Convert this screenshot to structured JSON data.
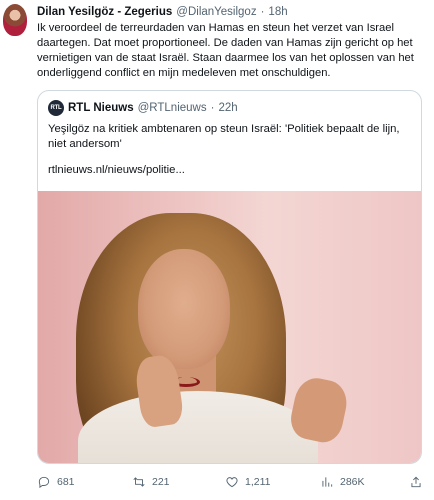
{
  "tweet": {
    "author_name": "Dilan Yesilgöz - Zegerius",
    "author_handle": "@DilanYesilgoz",
    "separator": "·",
    "time": "18h",
    "text": "Ik veroordeel de terreurdaden van Hamas en steun het verzet van Israel daartegen. Dat moet proportioneel. De daden van Hamas zijn gericht op het vernietigen van de staat Israël. Staan daarmee los van het oplossen van het onderliggend conflict en mijn medeleven met onschuldigen."
  },
  "quote": {
    "logo_text": "RTL",
    "name": "RTL Nieuws",
    "handle": "@RTLnieuws",
    "separator": "·",
    "time": "22h",
    "text": "Yeşilgöz na kritiek ambtenaren op steun Israël: 'Politiek bepaalt de lijn, niet andersom'",
    "link": "rtlnieuws.nl/nieuws/politie..."
  },
  "actions": {
    "replies": "681",
    "retweets": "221",
    "likes": "1,211",
    "views": "286K"
  },
  "icons": {
    "reply": "reply-icon",
    "retweet": "retweet-icon",
    "like": "heart-icon",
    "views": "views-icon",
    "bookmark": "bookmark-icon"
  },
  "colors": {
    "text": "#0f1419",
    "muted": "#536471",
    "border": "#cfd9de"
  }
}
